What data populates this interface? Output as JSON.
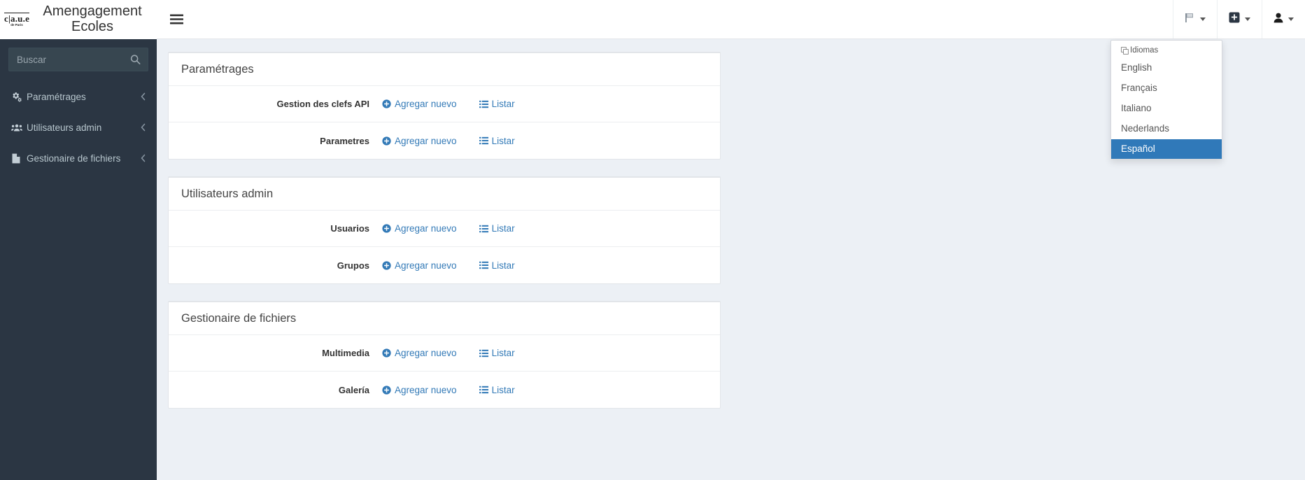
{
  "brand": {
    "logo_mark": "c|a.u.e",
    "logo_sub": "de Paris",
    "title": "Amengagement Ecoles"
  },
  "search": {
    "placeholder": "Buscar",
    "value": "",
    "icon": "search-icon"
  },
  "sidebar": {
    "items": [
      {
        "label": "Paramétrages",
        "icon": "gears-icon",
        "chevron": "chevron-left-icon"
      },
      {
        "label": "Utilisateurs admin",
        "icon": "users-icon",
        "chevron": "chevron-left-icon"
      },
      {
        "label": "Gestionaire de fichiers",
        "icon": "file-icon",
        "chevron": "chevron-left-icon"
      }
    ]
  },
  "topbar": {
    "menu_toggle_icon": "hamburger-icon",
    "buttons": [
      {
        "icon": "flag-icon",
        "name": "language-switcher"
      },
      {
        "icon": "plus-square-icon",
        "name": "quick-add"
      },
      {
        "icon": "user-icon",
        "name": "user-account"
      }
    ]
  },
  "language_dropdown": {
    "header": "Idiomas",
    "header_icon": "language-icon",
    "active_value": "Español",
    "options": [
      {
        "label": "English",
        "active": false
      },
      {
        "label": "Français",
        "active": false
      },
      {
        "label": "Italiano",
        "active": false
      },
      {
        "label": "Nederlands",
        "active": false
      },
      {
        "label": "Español",
        "active": true
      }
    ]
  },
  "main": {
    "panels": [
      {
        "title": "Paramétrages",
        "rows": [
          {
            "label": "Gestion des clefs API",
            "add_label": "Agregar nuevo",
            "list_label": "Listar"
          },
          {
            "label": "Parametres",
            "add_label": "Agregar nuevo",
            "list_label": "Listar"
          }
        ]
      },
      {
        "title": "Utilisateurs admin",
        "rows": [
          {
            "label": "Usuarios",
            "add_label": "Agregar nuevo",
            "list_label": "Listar"
          },
          {
            "label": "Grupos",
            "add_label": "Agregar nuevo",
            "list_label": "Listar"
          }
        ]
      },
      {
        "title": "Gestionaire de fichiers",
        "rows": [
          {
            "label": "Multimedia",
            "add_label": "Agregar nuevo",
            "list_label": "Listar"
          },
          {
            "label": "Galería",
            "add_label": "Agregar nuevo",
            "list_label": "Listar"
          }
        ]
      }
    ]
  },
  "colors": {
    "sidebar_bg": "#2b3643",
    "link_blue": "#337ab7",
    "active_blue": "#3079b9",
    "page_bg": "#ecf0f5"
  }
}
